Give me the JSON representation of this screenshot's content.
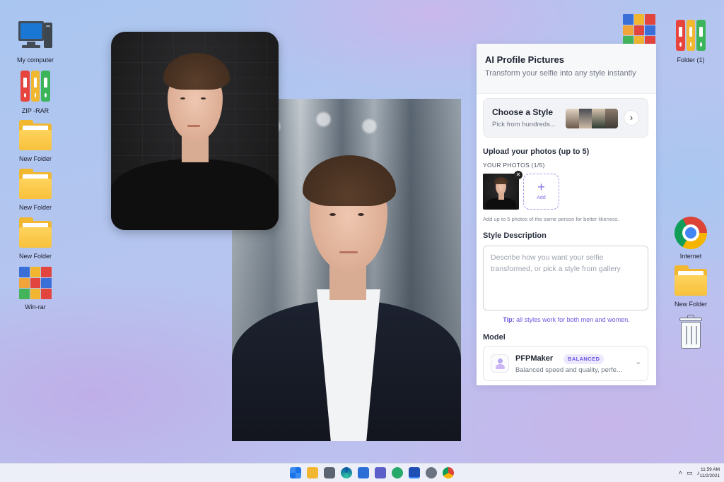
{
  "desktop": {
    "left_icons": [
      {
        "label": "My computer",
        "icon": "computer-icon"
      },
      {
        "label": "ZIP -RAR",
        "icon": "zip-rar-icon"
      },
      {
        "label": "New Folder",
        "icon": "folder-icon"
      },
      {
        "label": "New Folder",
        "icon": "folder-icon"
      },
      {
        "label": "New Folder",
        "icon": "folder-icon"
      },
      {
        "label": "Win-rar",
        "icon": "winrar-icon"
      }
    ],
    "right_icons": [
      {
        "label": "Folder (1)",
        "icon": "binder-folder-icon"
      },
      {
        "label": "Internet",
        "icon": "chrome-icon"
      },
      {
        "label": "New Folder",
        "icon": "folder-icon"
      },
      {
        "label": "",
        "icon": "recycle-bin-icon"
      }
    ]
  },
  "app": {
    "title": "AI Profile Pictures",
    "subtitle": "Transform your selfie into any style instantly",
    "style_card": {
      "title": "Choose a Style",
      "subtitle": "Pick from hundreds..."
    },
    "upload": {
      "heading": "Upload your photos (up to 5)",
      "photos_label": "YOUR PHOTOS (1/5)",
      "add_label": "Add",
      "add_symbol": "+",
      "hint": "Add up to 5 photos of the same person for better likeness."
    },
    "style_description": {
      "heading": "Style Description",
      "placeholder": "Describe how you want your selfie transformed, or pick a style from gallery"
    },
    "tip": {
      "prefix": "Tip:",
      "text": " all styles work for both men and women."
    },
    "model": {
      "heading": "Model",
      "name": "PFPMaker",
      "badge": "BALANCED",
      "description": "Balanced speed and quality, perfe..."
    }
  },
  "taskbar": {
    "apps": [
      "windows-start-icon",
      "file-explorer-icon",
      "camera-icon",
      "edge-icon",
      "store-icon",
      "teams-icon",
      "maps-icon",
      "app-icon",
      "settings-icon",
      "chrome-icon"
    ],
    "clock_time": "11:59 AM",
    "clock_date": "11/2/2021"
  },
  "colors": {
    "accent": "#6b57de",
    "folder": "#f7c13d"
  }
}
